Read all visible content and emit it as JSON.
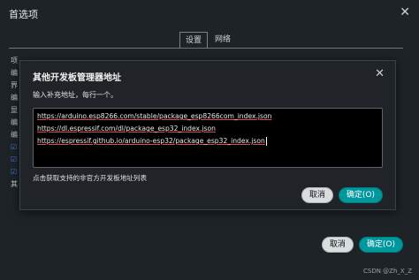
{
  "window": {
    "title": "首选项"
  },
  "tabs": [
    {
      "label": "设置"
    },
    {
      "label": "网络"
    }
  ],
  "dialog": {
    "title": "其他开发板管理器地址",
    "instruction": "输入补充地址，每行一个。",
    "urls": [
      "https://arduino.esp8266.com/stable/package_esp8266com_index.json",
      "https://dl.espressif.com/dl/package_esp32_index.json",
      "https://espressif.github.io/arduino-esp32/package_esp32_index.json"
    ],
    "link_text": "点击获取支持的非官方开发板地址列表",
    "cancel_label": "取消",
    "ok_label": "确定(O)"
  },
  "main_buttons": {
    "cancel_label": "取消",
    "ok_label": "确定(O)"
  },
  "watermark": "CSDN @Zh_X_Z",
  "colors": {
    "accent": "#00979d",
    "background": "#1e2327",
    "text_area": "#000000"
  }
}
